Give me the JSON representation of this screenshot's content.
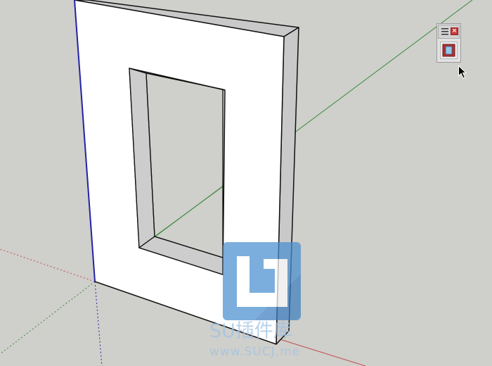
{
  "application": "SketchUp",
  "viewport": {
    "background_color": "#cfcfcb",
    "axis_colors": {
      "red": "#c05050",
      "green": "#3c8a3c",
      "blue": "#2424a8"
    },
    "model": {
      "object": "wall-panel-with-rectangular-opening",
      "face_color": "#ffffff",
      "side_color": "#cfcfcf",
      "edge_color": "#111111"
    }
  },
  "toolbar": {
    "close_glyph": "×",
    "grip_icon": "grip-lines-icon",
    "tool_icon": "window-frame-icon",
    "accent_color": "#c83a3a",
    "icon_fill_color": "#8fc8e8"
  },
  "cursor": {
    "icon": "arrow-pointer-icon"
  },
  "watermark": {
    "brand": "SU插件库",
    "url": "www.SUCJ.me",
    "color": "#4a8fd0"
  }
}
